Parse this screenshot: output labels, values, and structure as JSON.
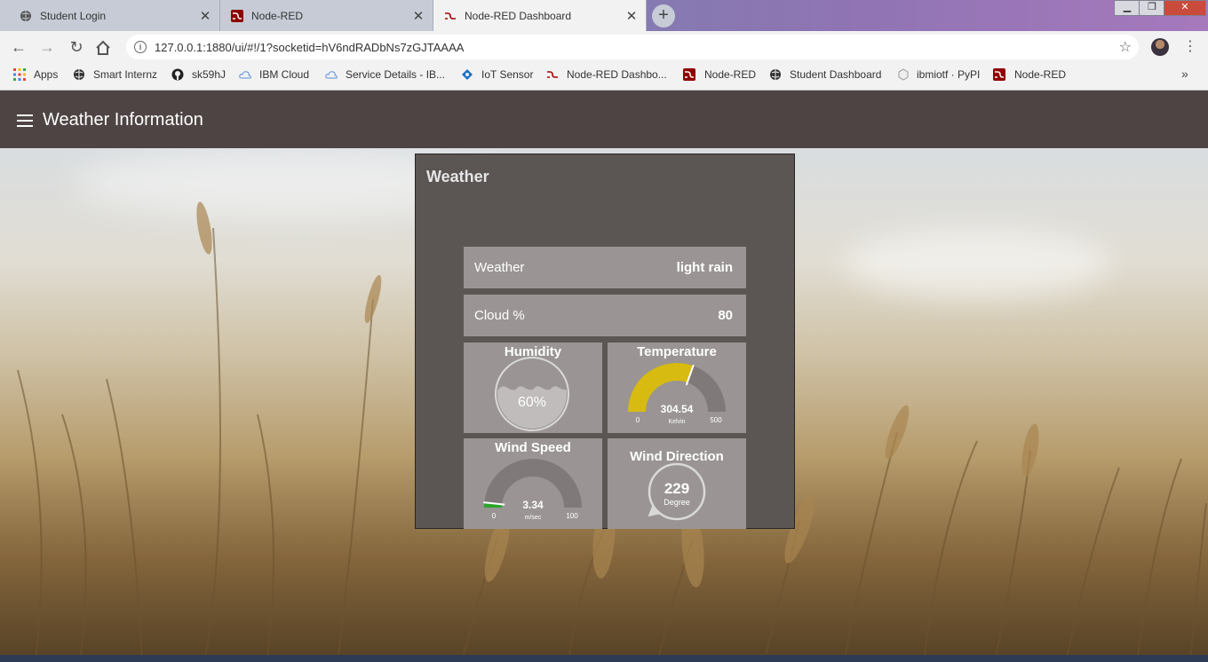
{
  "browser": {
    "tabs": [
      {
        "title": "Student Login",
        "icon": "globe-icon"
      },
      {
        "title": "Node-RED",
        "icon": "node-red-icon"
      },
      {
        "title": "Node-RED Dashboard",
        "icon": "node-red-dashboard-icon",
        "active": true
      }
    ],
    "url": "127.0.0.1:1880/ui/#!/1?socketid=hV6ndRADbNs7zGJTAAAA",
    "bookmarks": [
      {
        "label": "Apps",
        "icon": "apps-grid-icon"
      },
      {
        "label": "Smart Internz",
        "icon": "globe-icon"
      },
      {
        "label": "sk59hJ",
        "icon": "github-icon"
      },
      {
        "label": "IBM Cloud",
        "icon": "cloud-icon"
      },
      {
        "label": "Service Details - IB...",
        "icon": "cloud-icon"
      },
      {
        "label": "IoT Sensor",
        "icon": "iot-icon"
      },
      {
        "label": "Node-RED Dashbo...",
        "icon": "node-red-dashboard-icon"
      },
      {
        "label": "Node-RED",
        "icon": "node-red-icon"
      },
      {
        "label": "Student Dashboard",
        "icon": "globe-icon"
      },
      {
        "label": "ibmiotf · PyPI",
        "icon": "package-icon"
      },
      {
        "label": "Node-RED",
        "icon": "node-red-icon"
      }
    ],
    "more_bookmarks": "»"
  },
  "dashboard": {
    "title": "Weather Information",
    "group_title": "Weather",
    "weather": {
      "label": "Weather",
      "value": "light rain"
    },
    "cloud": {
      "label": "Cloud %",
      "value": "80"
    },
    "humidity": {
      "title": "Humidity",
      "value": 60,
      "display": "60%"
    },
    "temperature": {
      "title": "Temperature",
      "value": 304.54,
      "display": "304.54",
      "unit": "Kelvin",
      "min": 0,
      "max": 500,
      "min_label": "0",
      "max_label": "500"
    },
    "wind_speed": {
      "title": "Wind Speed",
      "value": 3.34,
      "display": "3.34",
      "unit": "m/sec",
      "min": 0,
      "max": 100,
      "min_label": "0",
      "max_label": "100"
    },
    "wind_direction": {
      "title": "Wind Direction",
      "value": 229,
      "display": "229",
      "unit": "Degree"
    }
  },
  "colors": {
    "header": "#4f4444",
    "group_bg": "#5b5554",
    "widget_bg": "#9a9594",
    "gauge_temp": "#d8bb10",
    "gauge_wind": "#2ba52b",
    "gauge_track": "#7f7a79"
  }
}
